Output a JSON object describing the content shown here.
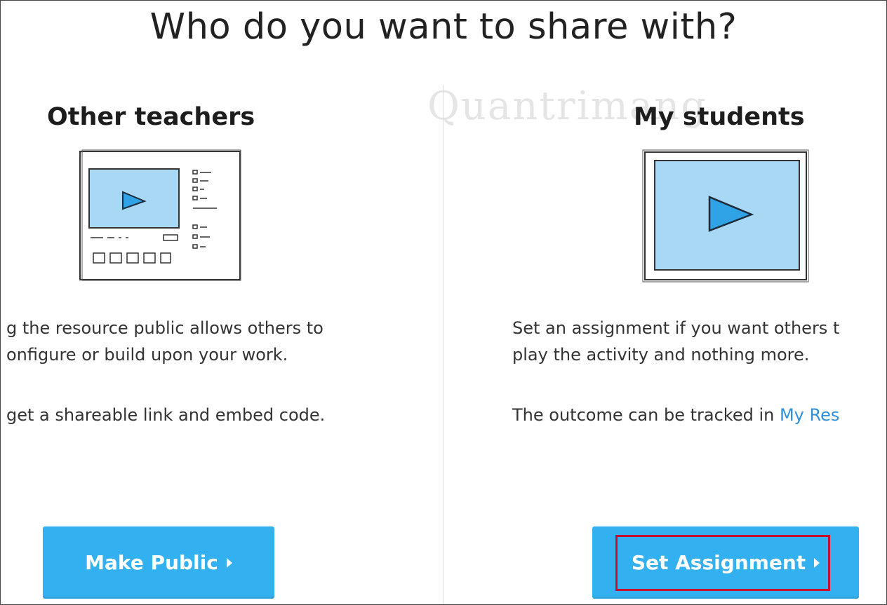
{
  "page": {
    "title": "Who do you want to share with?"
  },
  "left": {
    "heading": "Other teachers",
    "desc_lines": [
      "g the resource public allows others to",
      "onfigure or build upon your work.",
      "get a shareable link and embed code."
    ],
    "button_label": "Make Public"
  },
  "right": {
    "heading": "My students",
    "desc_lines": [
      "Set an assignment if you want others t",
      "play the activity and nothing more."
    ],
    "desc_outcome_prefix": "The outcome can be tracked in ",
    "desc_outcome_link": "My Res",
    "button_label": "Set Assignment"
  },
  "watermark": "Quantrimang",
  "colors": {
    "button": "#33b0f0",
    "link": "#2f8fd8",
    "highlight": "#c8102e",
    "screen_fill": "#a9d8f5",
    "play_fill": "#2fa3e6"
  },
  "icons": {
    "caret": "caret-right-icon",
    "play": "play-icon"
  }
}
